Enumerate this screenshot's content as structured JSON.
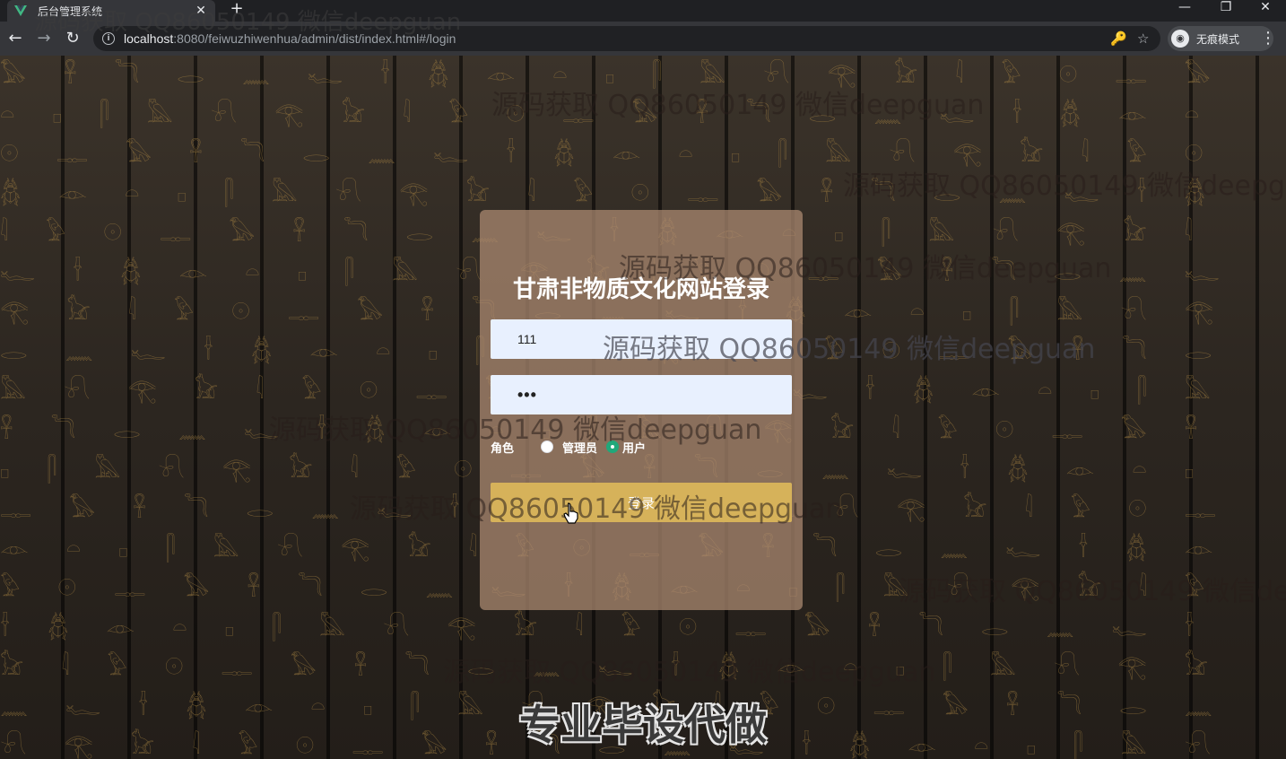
{
  "browser": {
    "tab_title": "后台管理系统",
    "tab_close": "✕",
    "new_tab": "+",
    "url_host": "localhost",
    "url_rest": ":8080/feiwuzhiwenhua/admin/dist/index.html#/login",
    "incognito_label": "无痕模式",
    "win_minimize": "—",
    "win_restore": "❐",
    "win_close": "✕",
    "back": "←",
    "forward": "→",
    "reload": "↻",
    "key_icon": "🔑",
    "star_icon": "☆",
    "menu": "⋮"
  },
  "login": {
    "title": "甘肃非物质文化网站登录",
    "username_value": "111",
    "password_value": "•••",
    "role_label": "角色",
    "role_options": [
      "管理员",
      "用户"
    ],
    "selected_role": "用户",
    "submit_label": "登录"
  },
  "watermark": "源码获取 QQ86050149 微信deepguan",
  "banner": "专业毕设代做",
  "glyph_rows": "𓅃𓆣𓂀𓋹𓁹𓃠𓆓𓏏𓇋𓂋𓊪𓅱𓈖𓋴𓇳𓆑𓅓𓊃𓌂𓍯"
}
